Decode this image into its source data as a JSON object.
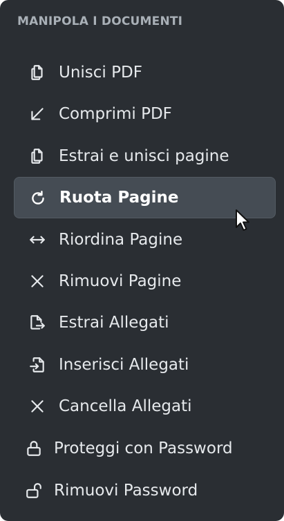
{
  "section": {
    "title": "MANIPOLA I DOCUMENTI"
  },
  "menu": {
    "items": [
      {
        "label": "Unisci PDF",
        "icon": "copy-icon",
        "active": false
      },
      {
        "label": "Comprimi PDF",
        "icon": "arrow-down-left-icon",
        "active": false
      },
      {
        "label": "Estrai e unisci pagine",
        "icon": "copy-icon",
        "active": false
      },
      {
        "label": "Ruota Pagine",
        "icon": "rotate-icon",
        "active": true
      },
      {
        "label": "Riordina Pagine",
        "icon": "arrows-horizontal-icon",
        "active": false
      },
      {
        "label": "Rimuovi Pagine",
        "icon": "x-icon",
        "active": false
      },
      {
        "label": "Estrai Allegati",
        "icon": "file-export-icon",
        "active": false
      },
      {
        "label": "Inserisci Allegati",
        "icon": "file-import-icon",
        "active": false
      },
      {
        "label": "Cancella Allegati",
        "icon": "x-icon",
        "active": false
      },
      {
        "label": "Proteggi con Password",
        "icon": "lock-icon",
        "active": false
      },
      {
        "label": "Rimuovi Password",
        "icon": "unlock-icon",
        "active": false
      }
    ]
  },
  "colors": {
    "background": "#2a2e33",
    "active_background": "#454c54",
    "text": "#e6e9ec",
    "section_title": "#a9b0b7"
  }
}
